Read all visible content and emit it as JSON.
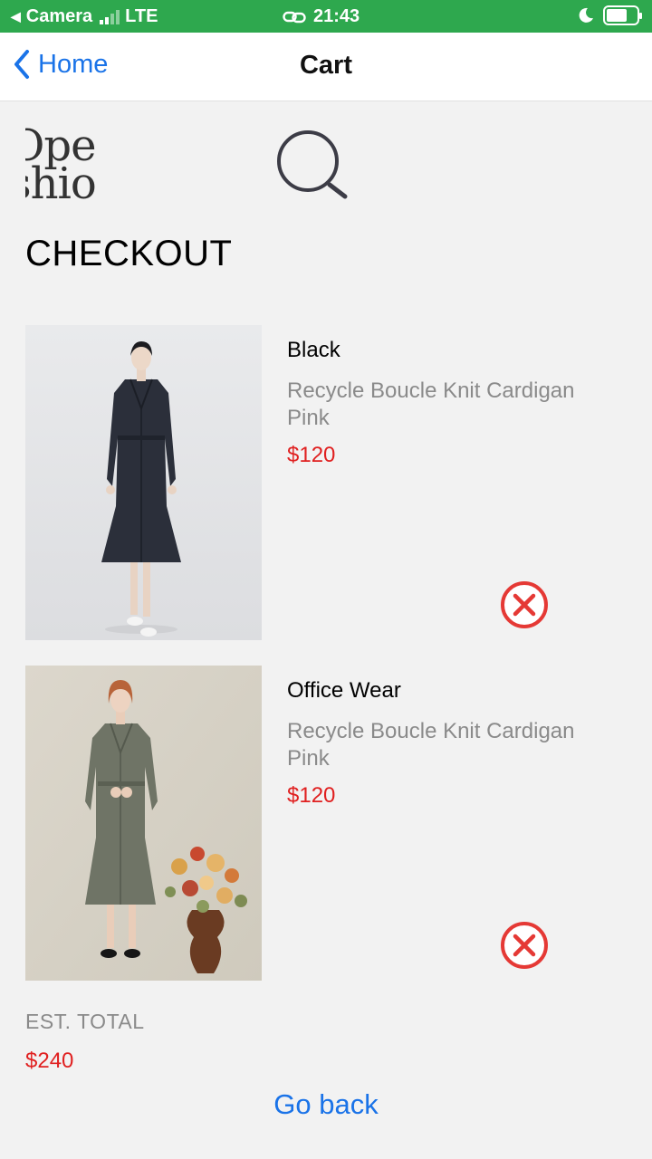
{
  "status_bar": {
    "back_app": "Camera",
    "network": "LTE",
    "time": "21:43"
  },
  "nav": {
    "back_label": "Home",
    "title": "Cart"
  },
  "logo": {
    "line1": "Ope",
    "line2": "shio"
  },
  "page_title": "CHECKOUT",
  "cart_items": [
    {
      "title": "Black",
      "description": "Recycle Boucle Knit Cardigan Pink",
      "price": "$120",
      "image": "black-dress-photo"
    },
    {
      "title": "Office Wear",
      "description": "Recycle Boucle Knit Cardigan Pink",
      "price": "$120",
      "image": "grey-dress-photo"
    }
  ],
  "total": {
    "label": "EST. TOTAL",
    "value": "$240"
  },
  "go_back_label": "Go back",
  "colors": {
    "status_bar": "#2ea84e",
    "link_blue": "#1a73e8",
    "price_red": "#e02020",
    "remove_red": "#e53935",
    "muted_text": "#8a8a8a",
    "background": "#f2f2f2"
  }
}
